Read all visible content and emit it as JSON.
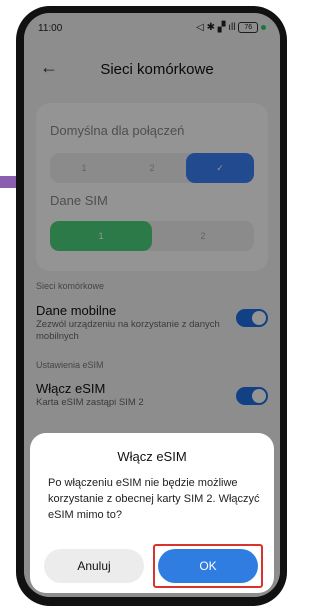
{
  "status_bar": {
    "time": "11:00",
    "battery": "76"
  },
  "header": {
    "title": "Sieci komórkowe"
  },
  "default_calls": {
    "label": "Domyślna dla połączeń",
    "options": [
      "1",
      "2",
      "✓"
    ]
  },
  "sim_data": {
    "label": "Dane SIM",
    "options": [
      "1",
      "2"
    ]
  },
  "sections": {
    "mobile_networks": "Sieci komórkowe",
    "esim_settings": "Ustawienia eSIM"
  },
  "mobile_data": {
    "title": "Dane mobilne",
    "subtitle": "Zezwól urządzeniu na korzystanie z danych mobilnych",
    "enabled": true
  },
  "esim": {
    "title": "Włącz eSIM",
    "subtitle": "Karta eSIM zastąpi SIM 2",
    "enabled": true
  },
  "dialog": {
    "title": "Włącz eSIM",
    "message": "Po włączeniu eSIM nie będzie możliwe korzystanie z obecnej karty SIM 2. Włączyć eSIM mimo to?",
    "cancel_label": "Anuluj",
    "ok_label": "OK"
  },
  "colors": {
    "accent": "#2f7de1",
    "highlight": "#d8342c",
    "sim_green": "#4cd27d"
  }
}
